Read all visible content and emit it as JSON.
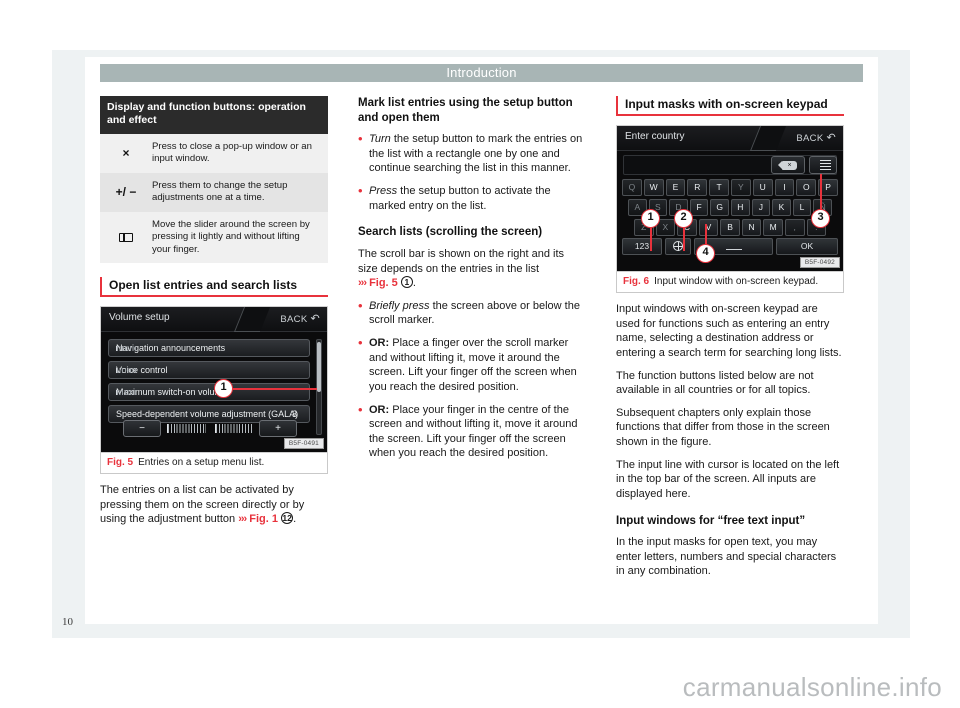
{
  "document": {
    "running_head": "Introduction",
    "page_number": "10",
    "watermark": "carmanualsonline.info"
  },
  "column_left": {
    "spec_table": {
      "header": "Display and function buttons: operation and effect",
      "rows": [
        {
          "icon": "close-x-icon",
          "symbol": "×",
          "description": "Press to close a pop-up window or an input window."
        },
        {
          "icon": "plus-minus-icon",
          "symbol": "+/ −",
          "description": "Press them to change the setup adjustments one at a time."
        },
        {
          "icon": "slider-icon",
          "symbol": "",
          "description": "Move the slider around the screen by pressing it lightly and without lifting your finger."
        }
      ]
    },
    "heading": "Open list entries and search lists",
    "figure": {
      "number": "Fig. 5",
      "caption": "Entries on a setup menu list.",
      "code": "B5F-0491",
      "screen": {
        "title": "Volume setup",
        "back_label": "BACK",
        "rows": [
          {
            "label": "Navigation announcements",
            "value": ""
          },
          {
            "label": "Voice control",
            "value": ""
          },
          {
            "label": "Maximum switch-on volume",
            "value": ""
          },
          {
            "label": "Speed-dependent volume adjustment (GALA)",
            "value": "3"
          }
        ],
        "minus_label": "−",
        "plus_label": "+",
        "callouts": [
          "1"
        ]
      }
    },
    "body": [
      "The entries on a list can be activated by pressing them on the screen directly or by using the adjustment button"
    ],
    "body_ref": {
      "arrow": "›››",
      "label": "Fig. 1",
      "circled": "12",
      "tail": "."
    }
  },
  "column_middle": {
    "heading_1": "Mark list entries using the setup button and open them",
    "bullets_1": [
      {
        "lead": "Turn",
        "lead_style": "italic",
        "text": " the setup button to mark the entries on the list with a rectangle one by one and continue searching the list in this manner."
      },
      {
        "lead": "Press",
        "lead_style": "italic",
        "text": " the setup button to activate the marked entry on the list."
      }
    ],
    "heading_2": "Search lists (scrolling the screen)",
    "paragraph_1": "The scroll bar is shown on the right and its size depends on the entries in the list",
    "paragraph_1_ref": {
      "arrow": "›››",
      "label": "Fig. 5",
      "circled": "1",
      "tail": "."
    },
    "bullets_2": [
      {
        "lead": "Briefly press",
        "lead_style": "italic",
        "text": " the screen above or below the scroll marker."
      },
      {
        "lead": "OR:",
        "lead_style": "bold",
        "text": " Place a finger over the scroll marker and without lifting it, move it around the screen. Lift your finger off the screen when you reach the desired position."
      },
      {
        "lead": "OR:",
        "lead_style": "bold",
        "text": " Place your finger in the centre of the screen and without lifting it, move it around the screen. Lift your finger off the screen when you reach the desired position."
      }
    ]
  },
  "column_right": {
    "heading": "Input masks with on-screen keypad",
    "figure": {
      "number": "Fig. 6",
      "caption": "Input window with on-screen keypad.",
      "code": "B5F-0492",
      "screen": {
        "title": "Enter country",
        "back_label": "BACK",
        "keyboard_rows": [
          [
            "Q",
            "W",
            "E",
            "R",
            "T",
            "Y",
            "U",
            "I",
            "O",
            "P"
          ],
          [
            "A",
            "S",
            "D",
            "F",
            "G",
            "H",
            "J",
            "K",
            "L",
            "Ñ"
          ],
          [
            "Z",
            "X",
            "C",
            "V",
            "B",
            "N",
            "M",
            ",",
            "."
          ]
        ],
        "numeric_key": "123",
        "language_key": "globe-icon",
        "space_key": "space-icon",
        "ok_key": "OK",
        "delete_key": "backspace-icon",
        "list_key": "list-icon",
        "callouts": [
          "1",
          "2",
          "3",
          "4"
        ]
      }
    },
    "paragraphs": [
      "Input windows with on-screen keypad are used for functions such as entering an entry name, selecting a destination address or entering a search term for searching long lists.",
      "The function buttons listed below are not available in all countries or for all topics.",
      "Subsequent chapters only explain those functions that differ from those in the screen shown in the figure.",
      "The input line with cursor is located on the left in the top bar of the screen. All inputs are displayed here."
    ],
    "heading_2": "Input windows for “free text input”",
    "paragraph_last": "In the input masks for open text, you may enter letters, numbers and special characters in any combination."
  },
  "colors": {
    "accent_red": "#e8323c",
    "running_head_bg": "#a8b5b5",
    "table_header_bg": "#2b2b2b",
    "page_bg": "#eef2f3"
  }
}
